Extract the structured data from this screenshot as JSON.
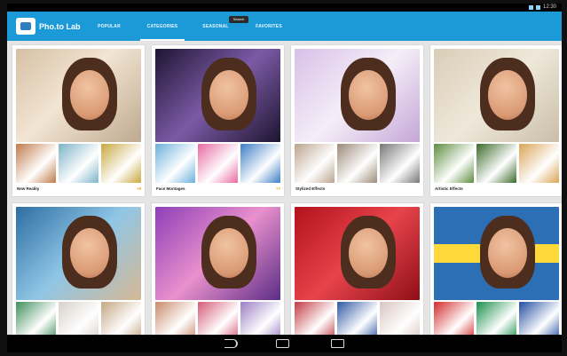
{
  "status": {
    "time": "12:30"
  },
  "app": {
    "title": "Pho.to Lab",
    "search_pill": "Search"
  },
  "tabs": [
    {
      "label": "POPULAR",
      "active": false
    },
    {
      "label": "CATEGORIES",
      "active": true
    },
    {
      "label": "SEASONAL",
      "active": false
    },
    {
      "label": "FAVORITES",
      "active": false
    }
  ],
  "cards": [
    {
      "title": "New Reality",
      "badge": "+9",
      "hero_bg": "linear-gradient(135deg,#d6c0a4,#f2e5d3 45%,#bfa98f)",
      "thumbs": [
        "#c07a4a",
        "#7cb3c7",
        "#c8a73f"
      ]
    },
    {
      "title": "Face Montages",
      "badge": "+7",
      "hero_bg": "linear-gradient(135deg,#1e1533,#7c5aa6 50%,#1d1530)",
      "thumbs": [
        "#6ab0da",
        "#e86aa2",
        "#3c7dc5"
      ]
    },
    {
      "title": "Stylized Effects",
      "badge": "",
      "hero_bg": "linear-gradient(135deg,#d8c0e8,#f5eef8 50%,#c4a6d7)",
      "thumbs": [
        "#bba48e",
        "#9b8a78",
        "#777"
      ]
    },
    {
      "title": "Artistic Effects",
      "badge": "",
      "hero_bg": "linear-gradient(135deg,#d9cdb7,#efe8da 50%,#c9bea8)",
      "thumbs": [
        "#5d8e3f",
        "#3b6b2a",
        "#d9a456"
      ]
    },
    {
      "title": "",
      "badge": "",
      "hero_bg": "linear-gradient(135deg,#2c6da2,#8fc6e6 50%,#d6b894)",
      "thumbs": [
        "#3e8e5a",
        "#d7d0c8",
        "#c4a783"
      ]
    },
    {
      "title": "",
      "badge": "",
      "hero_bg": "linear-gradient(135deg,#8e3fb8,#e990cd 50%,#5b2d86)",
      "thumbs": [
        "#c98a6a",
        "#d45a76",
        "#9b7fc4"
      ]
    },
    {
      "title": "",
      "badge": "",
      "hero_bg": "linear-gradient(135deg,#b3121c,#e7434b 50%,#8f0f17)",
      "thumbs": [
        "#c23b42",
        "#2f58a3",
        "#d8c6c0"
      ]
    },
    {
      "title": "",
      "badge": "",
      "hero_bg": "linear-gradient(180deg,#2d6fb5 0%,#2d6fb5 40%,#ffd83a 40%,#ffd83a 60%,#2d6fb5 60%)",
      "thumbs": [
        "#d32a2a",
        "#1b8f4a",
        "#234ea3"
      ]
    }
  ],
  "colors": {
    "appbar": "#1c9ad8",
    "badge": "#f2a41b"
  },
  "navbar": {
    "icons": [
      "back-icon",
      "home-icon",
      "recent-apps-icon"
    ]
  }
}
